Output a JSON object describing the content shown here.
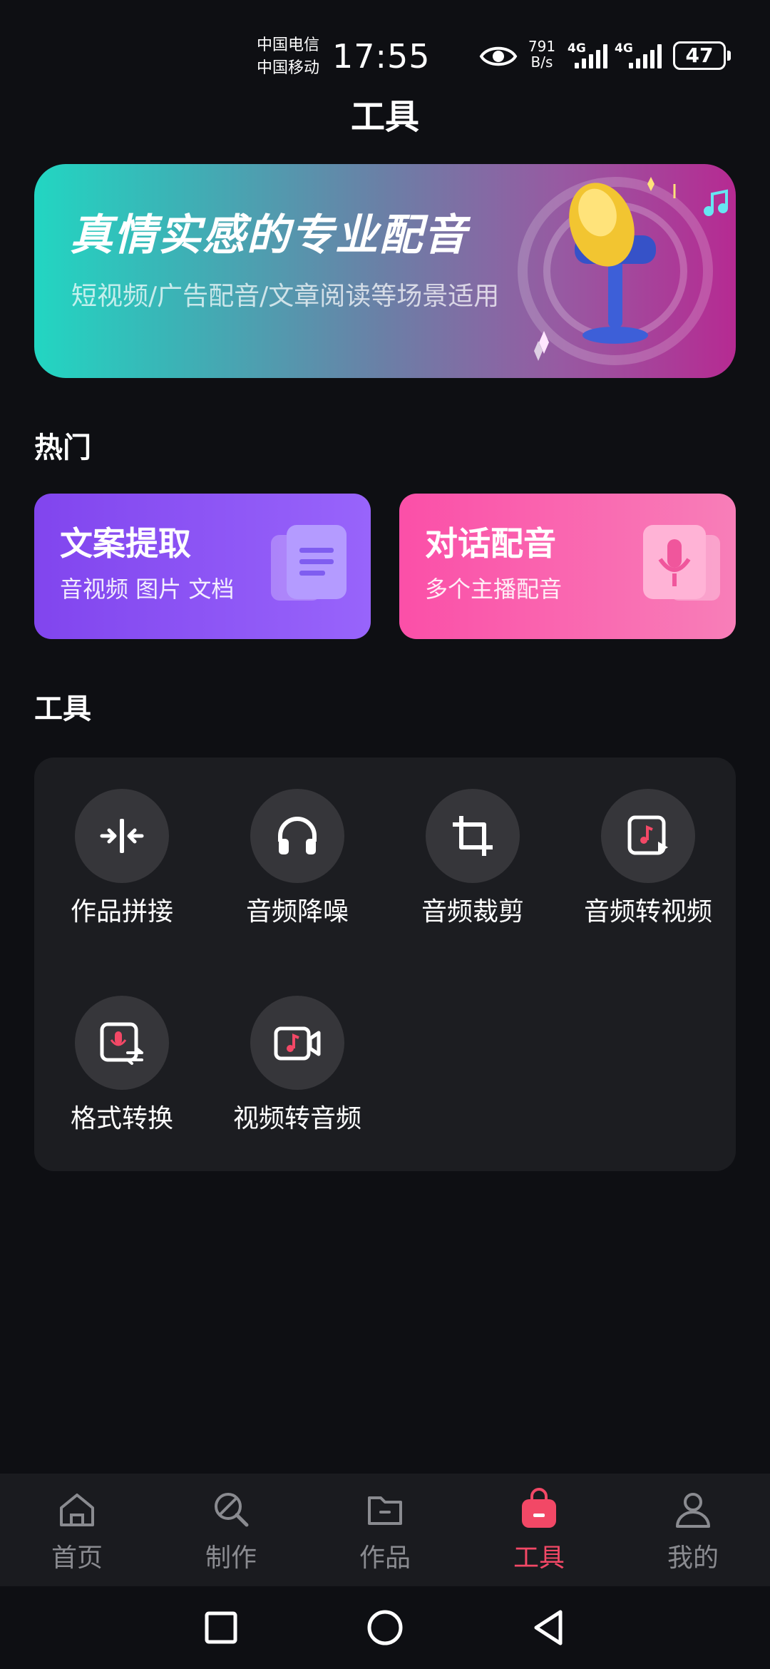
{
  "status_bar": {
    "carrier_1": "中国电信",
    "carrier_2": "中国移动",
    "time": "17:55",
    "net_speed_value": "791",
    "net_speed_unit": "B/s",
    "signal_1_label": "4G",
    "signal_2_label": "4G",
    "battery": "47"
  },
  "header": {
    "title": "工具"
  },
  "banner": {
    "title": "真情实感的专业配音",
    "subtitle": "短视频/广告配音/文章阅读等场景适用"
  },
  "hot": {
    "section_title": "热门",
    "cards": [
      {
        "title": "文案提取",
        "subtitle": "音视频 图片 文档",
        "icon": "document-icon"
      },
      {
        "title": "对话配音",
        "subtitle": "多个主播配音",
        "icon": "microphone-card-icon"
      }
    ]
  },
  "tools": {
    "section_title": "工具",
    "items": [
      {
        "label": "作品拼接",
        "icon": "merge-icon"
      },
      {
        "label": "音频降噪",
        "icon": "headphones-icon"
      },
      {
        "label": "音频裁剪",
        "icon": "crop-icon"
      },
      {
        "label": "音频转视频",
        "icon": "audio-to-video-icon"
      },
      {
        "label": "格式转换",
        "icon": "format-convert-icon"
      },
      {
        "label": "视频转音频",
        "icon": "video-to-audio-icon"
      }
    ]
  },
  "bottom_nav": {
    "active_color": "#f24866",
    "items": [
      {
        "label": "首页",
        "icon": "home-icon"
      },
      {
        "label": "制作",
        "icon": "create-icon"
      },
      {
        "label": "作品",
        "icon": "folder-icon"
      },
      {
        "label": "工具",
        "icon": "toolbox-icon",
        "active": true
      },
      {
        "label": "我的",
        "icon": "profile-icon"
      }
    ]
  },
  "system_nav": [
    "recent-apps-button",
    "home-button",
    "back-button"
  ]
}
